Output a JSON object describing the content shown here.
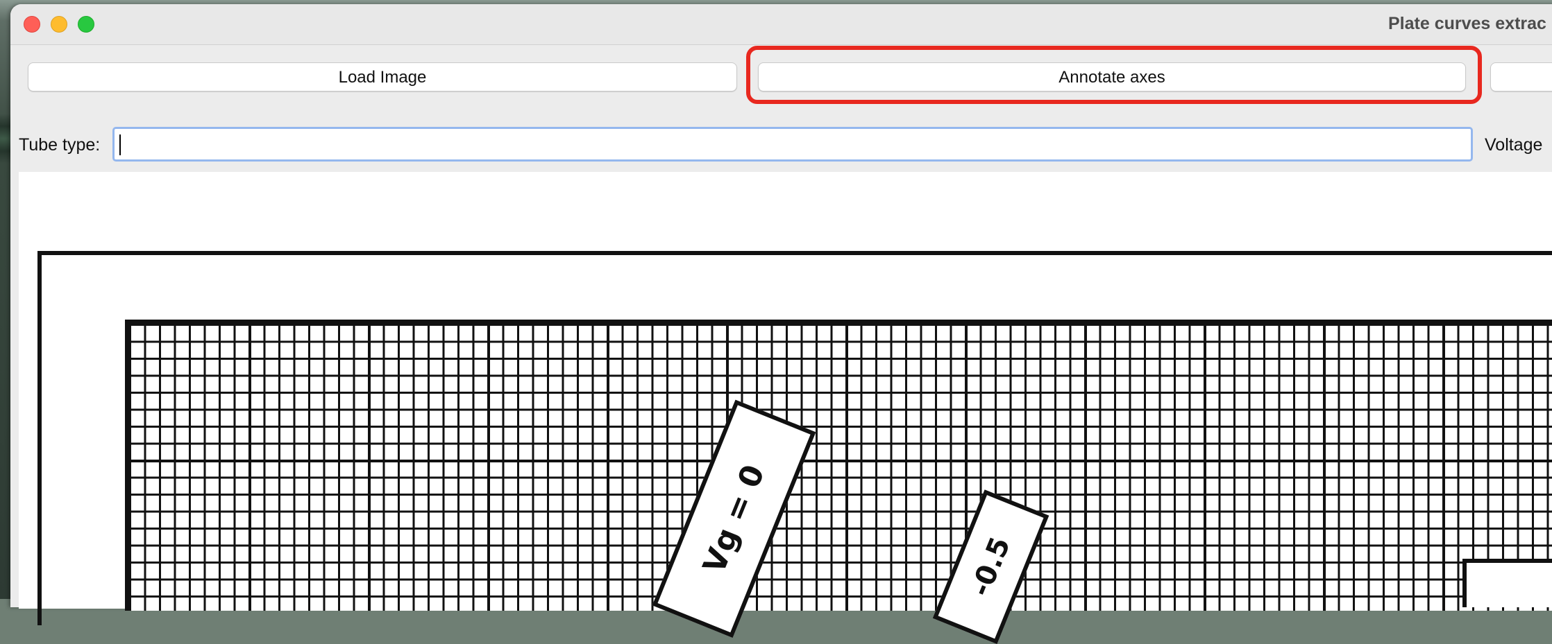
{
  "window": {
    "title": "Plate curves extrac"
  },
  "toolbar": {
    "load_label": "Load Image",
    "annotate_label": "Annotate axes",
    "next_label": ""
  },
  "form": {
    "tube_label": "Tube type:",
    "tube_value": "",
    "voltage_label": "Voltage"
  },
  "image": {
    "tag1_text": "Vg = 0",
    "tag2_text": "-0.5"
  },
  "colors": {
    "highlight": "#e8281f",
    "focus_ring": "#94b7ee",
    "close": "#fe5f57",
    "minimize": "#febc2e",
    "maximize": "#28c840"
  }
}
